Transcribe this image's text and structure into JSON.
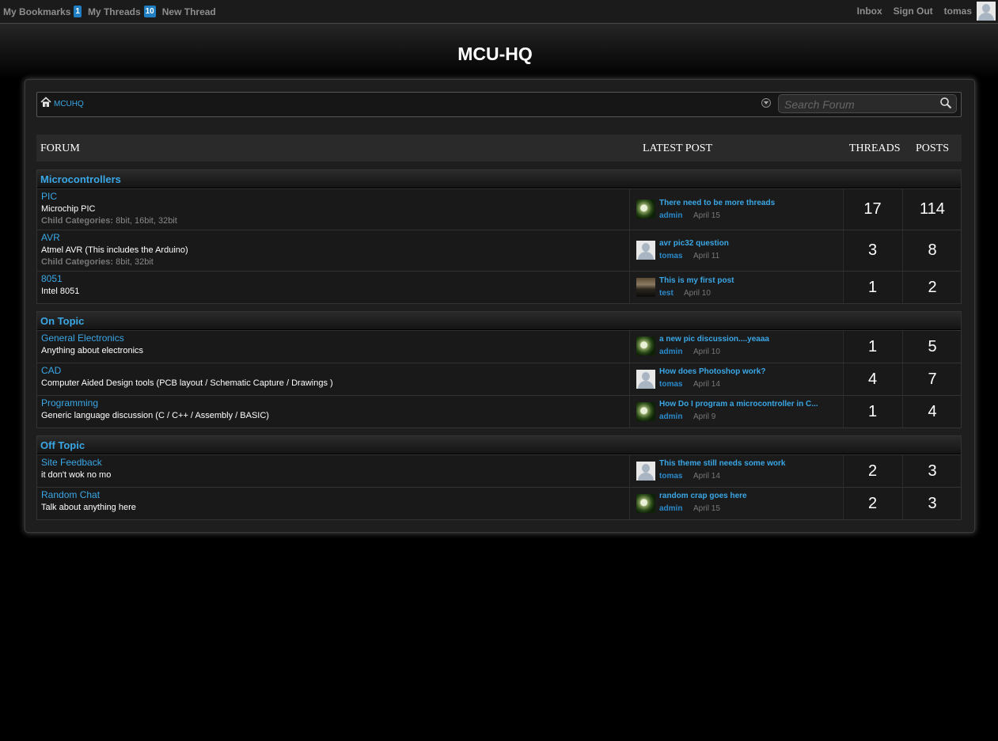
{
  "topbar": {
    "bookmarks_label": "My Bookmarks",
    "bookmarks_count": "1",
    "threads_label": "My Threads",
    "threads_count": "10",
    "new_thread_label": "New Thread",
    "inbox_label": "Inbox",
    "signout_label": "Sign Out",
    "username": "tomas"
  },
  "site_title": "MCU-HQ",
  "breadcrumb": {
    "home": "MCUHQ"
  },
  "search": {
    "placeholder": "Search Forum"
  },
  "columns": {
    "forum": "FORUM",
    "latest": "LATEST POST",
    "threads": "THREADS",
    "posts": "POSTS"
  },
  "child_categories_label": "Child Categories:",
  "sections": [
    {
      "title": "Microcontrollers",
      "forums": [
        {
          "name": "PIC",
          "desc": "Microchip PIC",
          "children": "8bit, 16bit, 32bit",
          "latest": {
            "title": "There need to be more threads",
            "author": "admin",
            "date": "April 15",
            "avatar": "admin"
          },
          "threads": "17",
          "posts": "114"
        },
        {
          "name": "AVR",
          "desc": "Atmel AVR (This includes the Arduino)",
          "children": "8bit, 32bit",
          "latest": {
            "title": "avr pic32 question",
            "author": "tomas",
            "date": "April 11",
            "avatar": "tomas"
          },
          "threads": "3",
          "posts": "8"
        },
        {
          "name": "8051",
          "desc": "Intel 8051",
          "latest": {
            "title": "This is my first post",
            "author": "test",
            "date": "April 10",
            "avatar": "test"
          },
          "threads": "1",
          "posts": "2"
        }
      ]
    },
    {
      "title": "On Topic",
      "forums": [
        {
          "name": "General Electronics",
          "desc": "Anything about electronics",
          "latest": {
            "title": "a new pic discussion....yeaaa",
            "author": "admin",
            "date": "April 10",
            "avatar": "admin"
          },
          "threads": "1",
          "posts": "5"
        },
        {
          "name": "CAD",
          "desc": "Computer Aided Design tools (PCB layout / Schematic Capture / Drawings )",
          "latest": {
            "title": "How does Photoshop work?",
            "author": "tomas",
            "date": "April 14",
            "avatar": "tomas"
          },
          "threads": "4",
          "posts": "7"
        },
        {
          "name": "Programming",
          "desc": "Generic language discussion (C / C++ / Assembly / BASIC)",
          "latest": {
            "title": "How Do I program a microcontroller in C...",
            "author": "admin",
            "date": "April 9",
            "avatar": "admin"
          },
          "threads": "1",
          "posts": "4"
        }
      ]
    },
    {
      "title": "Off Topic",
      "forums": [
        {
          "name": "Site Feedback",
          "desc": "it don't wok no mo",
          "latest": {
            "title": "This theme still needs some work",
            "author": "tomas",
            "date": "April 14",
            "avatar": "tomas"
          },
          "threads": "2",
          "posts": "3"
        },
        {
          "name": "Random Chat",
          "desc": "Talk about anything here",
          "latest": {
            "title": "random crap goes here",
            "author": "admin",
            "date": "April 15",
            "avatar": "admin"
          },
          "threads": "2",
          "posts": "3"
        }
      ]
    }
  ]
}
